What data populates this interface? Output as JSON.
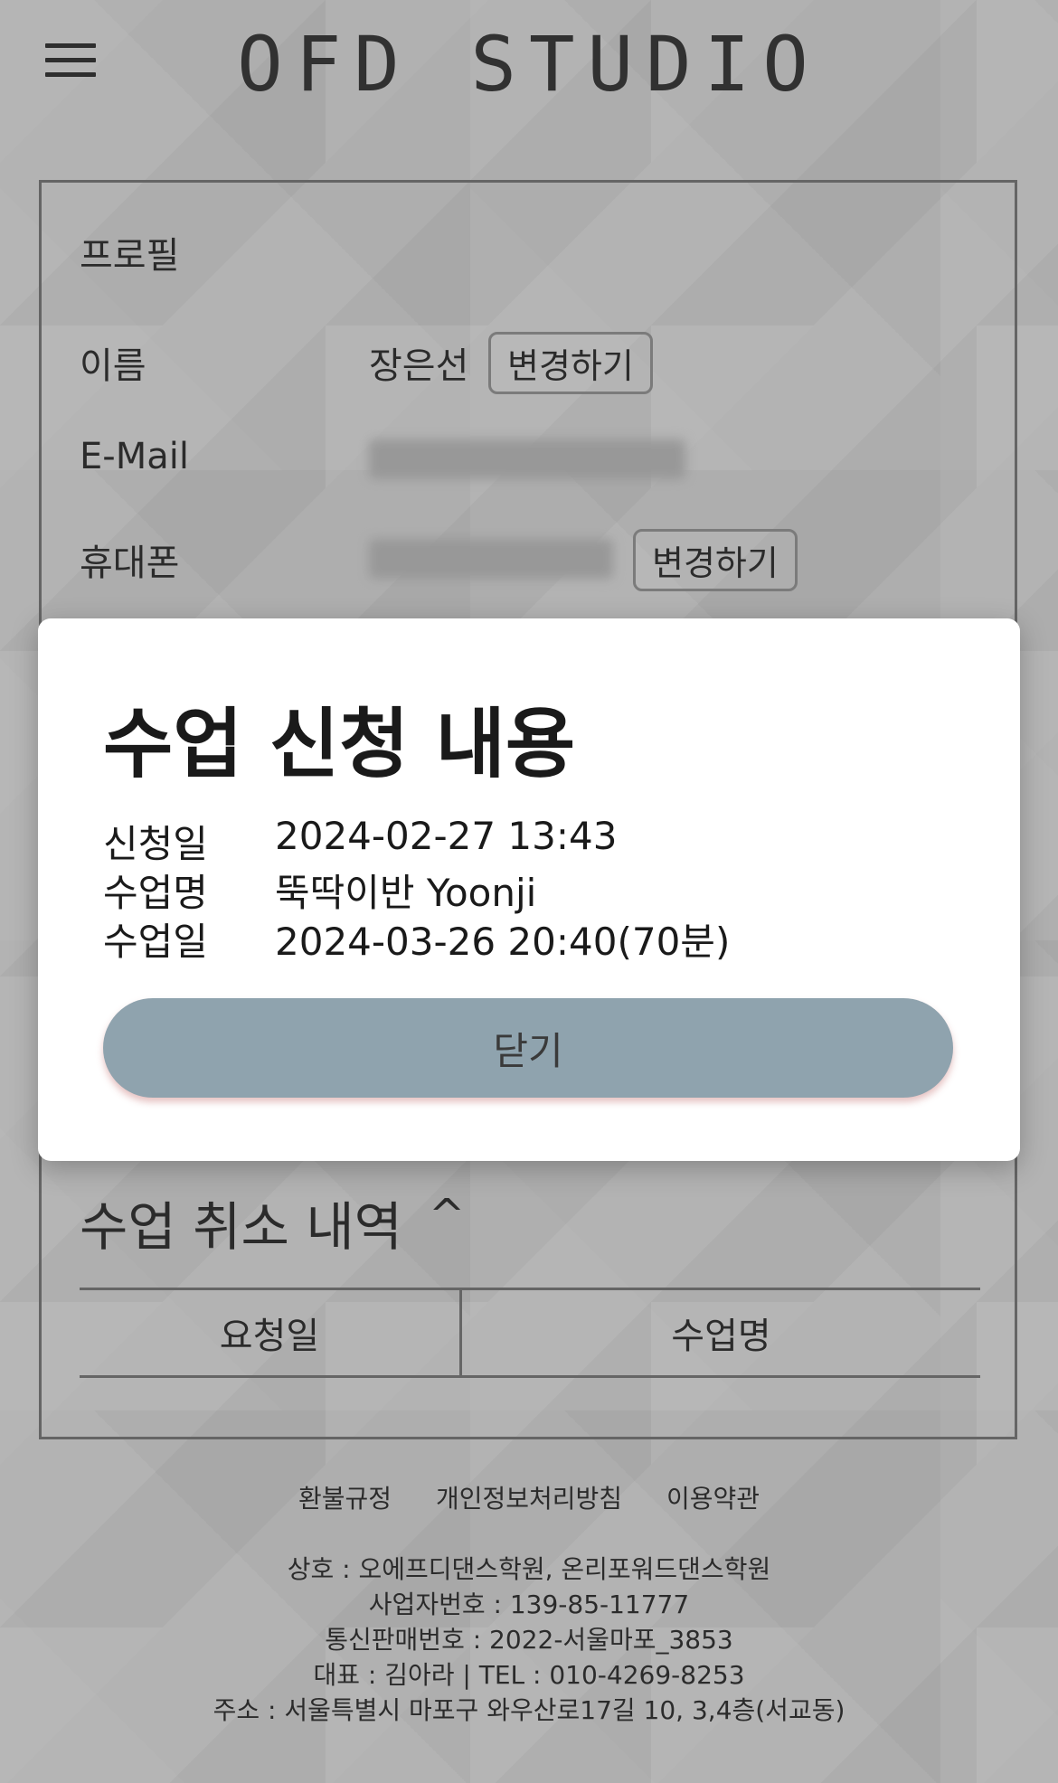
{
  "header": {
    "logo": "OFD STUDIO",
    "menu_icon": "hamburger-icon"
  },
  "profile": {
    "title": "프로필",
    "name_label": "이름",
    "name_value": "장은선",
    "change_label": "변경하기",
    "email_label": "E-Mail",
    "phone_label": "휴대폰"
  },
  "cancel_section": {
    "title": "수업 취소 내역",
    "caret": "^",
    "columns": [
      "요청일",
      "수업명"
    ]
  },
  "footer": {
    "links": [
      "환불규정",
      "개인정보처리방침",
      "이용약관"
    ],
    "info": [
      "상호 : 오에프디댄스학원, 온리포워드댄스학원",
      "사업자번호 : 139-85-11777",
      "통신판매번호 : 2022-서울마포_3853",
      "대표 : 김아라 | TEL : 010-4269-8253",
      "주소 : 서울특별시 마포구 와우산로17길 10, 3,4층(서교동)"
    ]
  },
  "modal": {
    "title": "수업 신청 내용",
    "rows": [
      {
        "label": "신청일",
        "value": "2024-02-27 13:43"
      },
      {
        "label": "수업명",
        "value": "뚝딱이반 Yoonji"
      },
      {
        "label": "수업일",
        "value": "2024-03-26 20:40(70분)"
      }
    ],
    "close_label": "닫기",
    "close_color": "#8fa3ae"
  }
}
